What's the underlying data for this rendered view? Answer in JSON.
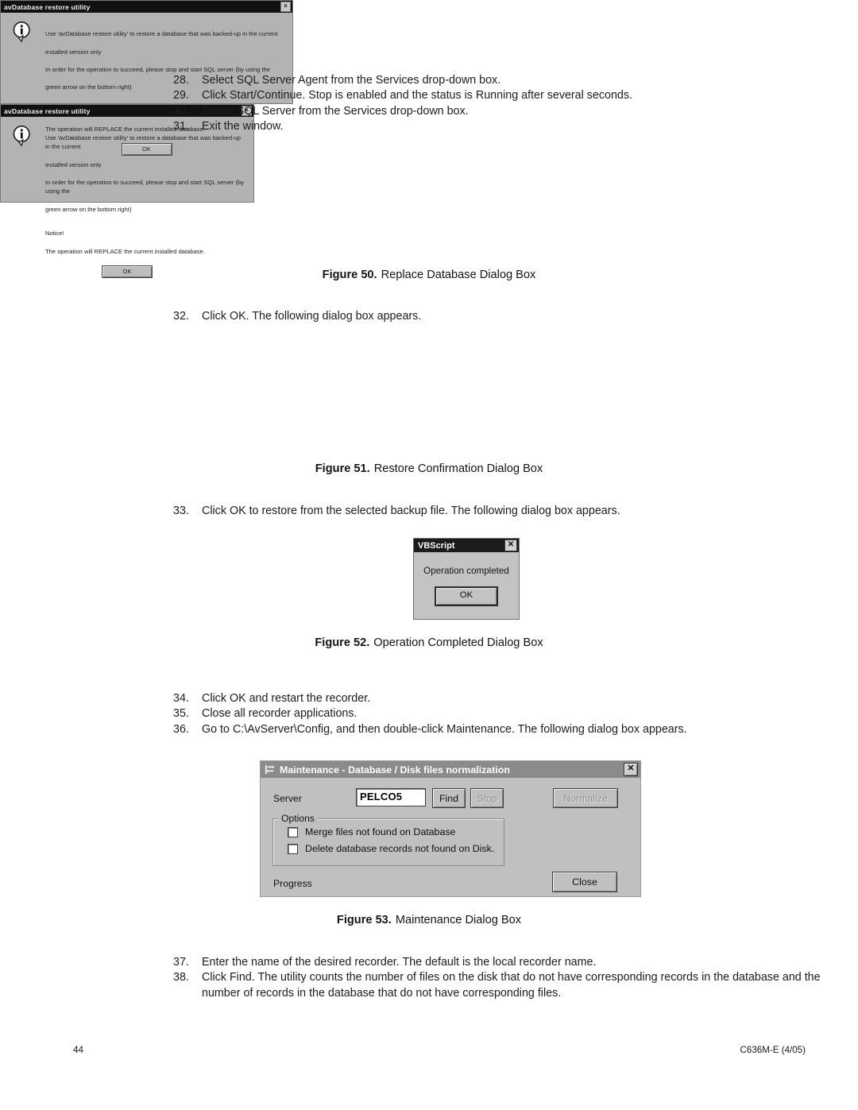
{
  "document": {
    "page_number": "44",
    "document_code": "C636M-E (4/05)"
  },
  "steps_group_1": [
    {
      "num": "28.",
      "text": "Select SQL Server Agent from the Services drop-down box."
    },
    {
      "num": "29.",
      "text": "Click Start/Continue. Stop is enabled and the status is Running after several seconds."
    },
    {
      "num": "30.",
      "text": "Select SQL Server from the Services drop-down box."
    },
    {
      "num": "31.",
      "text": "Exit the window."
    }
  ],
  "steps_group_2": [
    {
      "num": "32.",
      "text": "Click OK. The following dialog box appears."
    }
  ],
  "steps_group_3": [
    {
      "num": "33.",
      "text": "Click OK to restore from the selected backup file. The following dialog box appears."
    }
  ],
  "steps_group_4": [
    {
      "num": "34.",
      "text": "Click OK and restart the recorder."
    },
    {
      "num": "35.",
      "text": "Close all recorder applications."
    },
    {
      "num": "36.",
      "text": "Go to C:\\AvServer\\Config, and then double-click Maintenance. The following dialog box appears."
    }
  ],
  "steps_group_5": [
    {
      "num": "37.",
      "text": "Enter the name of the desired recorder. The default is the local recorder name."
    },
    {
      "num": "38.",
      "text": "Click Find. The utility counts the number of files on the disk that do not have corresponding records in the database and the number of records in the database that do not have corresponding files."
    }
  ],
  "captions": {
    "fig50_label": "Figure 50.",
    "fig50_text": "Replace Database Dialog Box",
    "fig51_label": "Figure 51.",
    "fig51_text": "Restore Confirmation Dialog Box",
    "fig52_label": "Figure 52.",
    "fig52_text": "Operation Completed Dialog Box",
    "fig53_label": "Figure 53.",
    "fig53_text": "Maintenance Dialog Box"
  },
  "dialog_replace_database": {
    "title": "avDatabase restore utility",
    "close_label": "×",
    "message_line1": "Use 'avDatabase restore utility' to restore a database that was backed-up in the current",
    "message_line2": "installed version only",
    "message_line3": "In order for the operation to succeed, please stop and start SQL server (by using the",
    "message_line4": "green arrow on the bottom right)",
    "message_line5": "Notice!",
    "message_line6": "The operation will REPLACE the current installed database.",
    "ok_label": "OK"
  },
  "dialog_restore_confirmation": {
    "title": "avDatabase restore utility",
    "close_label": "×",
    "message_line1": "Use 'avDatabase restore utility' to restore a database that was backed-up in the current",
    "message_line2": "installed version only",
    "message_line3": "In order for the operation to succeed, please stop and start SQL server (by using the",
    "message_line4": "green arrow on the bottom right)",
    "message_line5": "Notice!",
    "message_line6": "The operation will REPLACE the current installed database.",
    "ok_label": "OK"
  },
  "dialog_vbscript": {
    "title": "VBScript",
    "close_label": "✕",
    "message": "Operation completed",
    "ok_label": "OK"
  },
  "dialog_maintenance": {
    "title": "Maintenance - Database / Disk files normalization",
    "close_label": "✕",
    "server_label": "Server",
    "server_value": "PELCO5",
    "find_label": "Find",
    "stop_label": "Stop",
    "normalize_label": "Normalize",
    "options_label": "Options",
    "checkbox_merge_label": "Merge files not found on Database",
    "checkbox_merge_checked": false,
    "checkbox_delete_label": "Delete database records not found on Disk.",
    "checkbox_delete_checked": false,
    "progress_label": "Progress",
    "close_button_label": "Close"
  }
}
